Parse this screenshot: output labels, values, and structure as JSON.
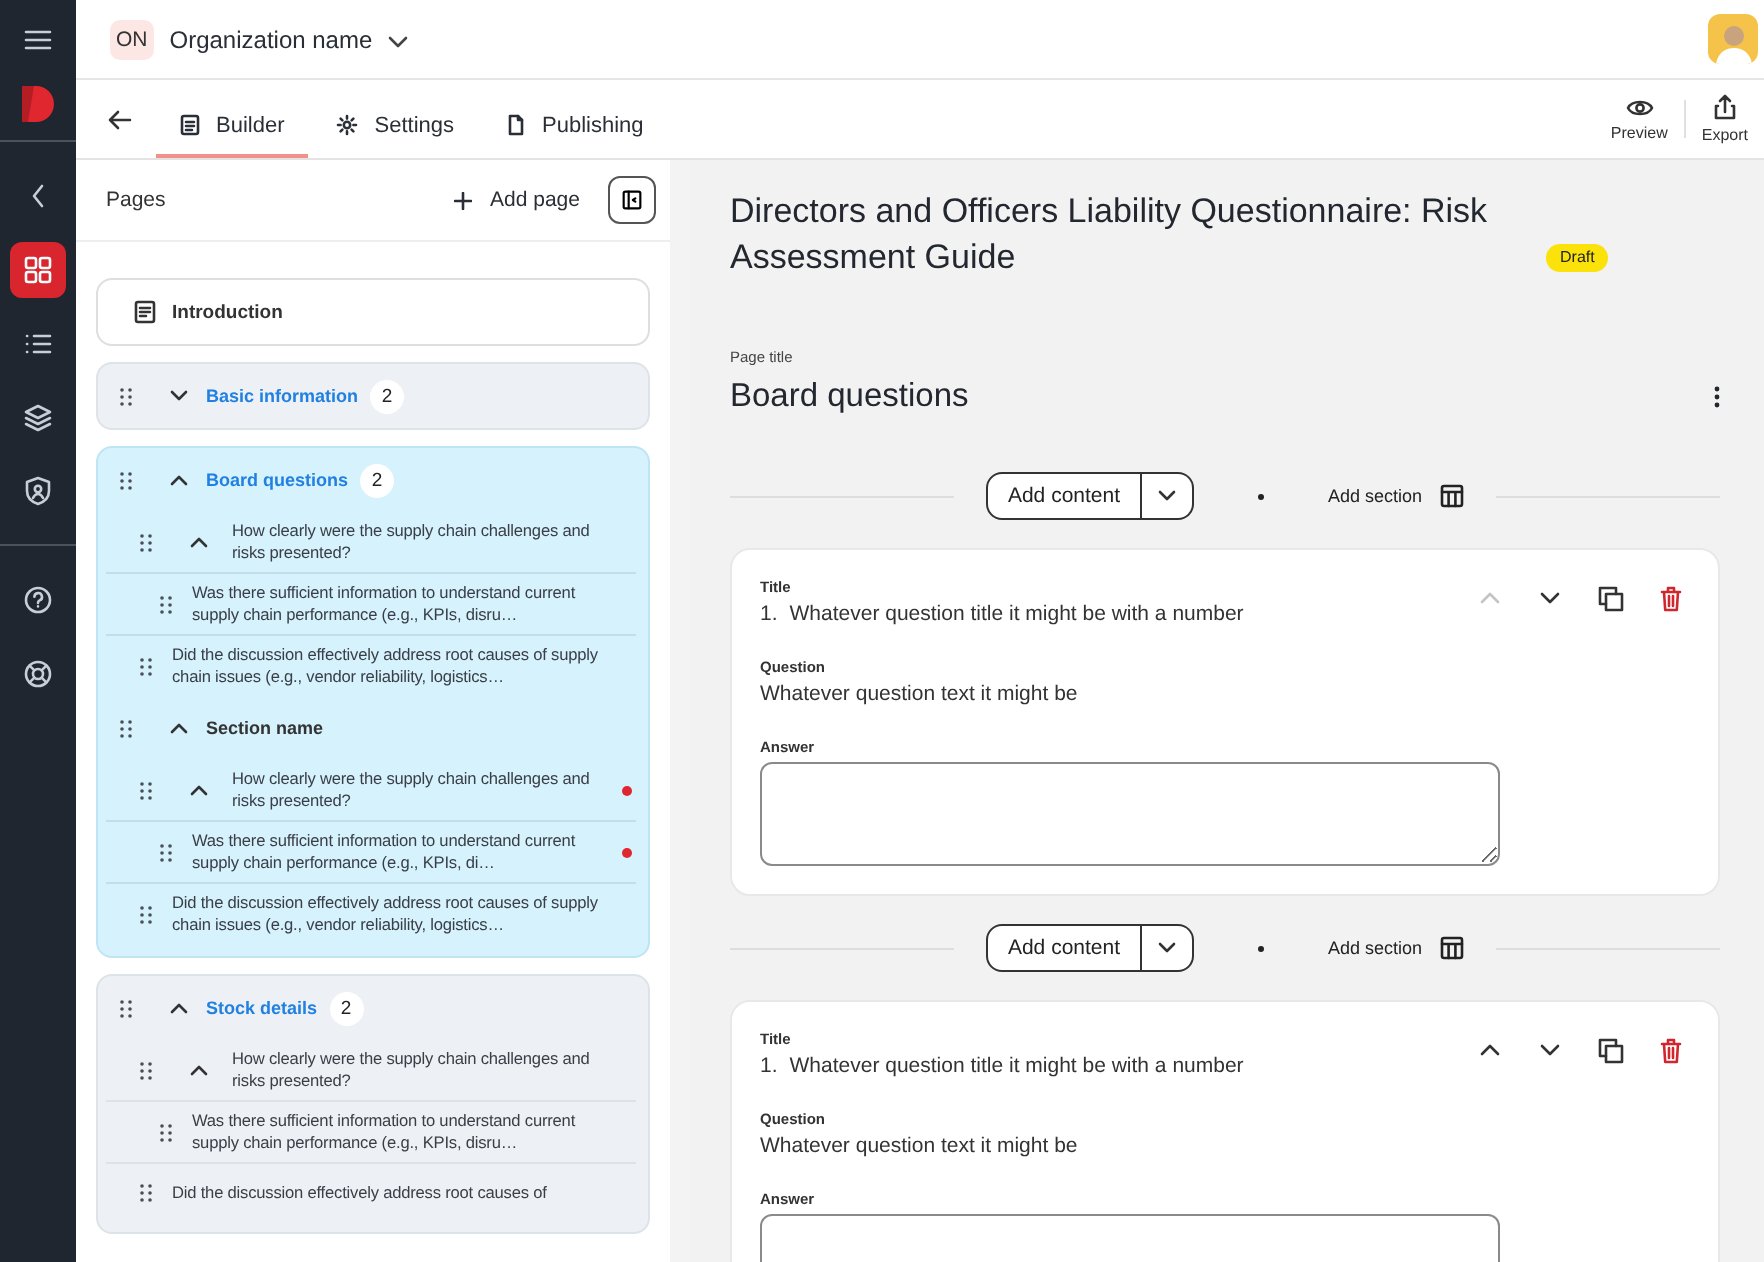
{
  "rail": {
    "items": [
      {
        "selected": false
      },
      {
        "selected": true
      },
      {
        "selected": false
      },
      {
        "selected": false
      },
      {
        "selected": false
      },
      {
        "selected": false
      },
      {
        "selected": false
      }
    ]
  },
  "topbar": {
    "org_initials": "ON",
    "org_name": "Organization name"
  },
  "toolbar": {
    "tabs": [
      {
        "label": "Builder",
        "selected": true
      },
      {
        "label": "Settings",
        "selected": false
      },
      {
        "label": "Publishing",
        "selected": false
      }
    ],
    "actions": [
      {
        "label": "Preview"
      },
      {
        "label": "Export"
      }
    ]
  },
  "pages": {
    "title": "Pages",
    "add_label": "Add page",
    "items": [
      {
        "kind": "page",
        "title": "Introduction"
      },
      {
        "kind": "group",
        "title": "Basic information",
        "count": "2",
        "expanded": false,
        "selected": false
      },
      {
        "kind": "group",
        "title": "Board questions",
        "count": "2",
        "expanded": true,
        "selected": true,
        "children": [
          {
            "kind": "question",
            "text": "How clearly were the supply chain challenges and risks presented?",
            "expanded": true,
            "flagged": false,
            "children": [
              {
                "kind": "question",
                "text": "Was there sufficient information to understand current supply chain performance (e.g., KPIs, disru…",
                "flagged": false
              }
            ]
          },
          {
            "kind": "question",
            "text": "Did the discussion effectively address root causes of supply chain issues (e.g., vendor reliability, logistics…",
            "flagged": false
          },
          {
            "kind": "section",
            "title": "Section name",
            "expanded": true,
            "children": [
              {
                "kind": "question",
                "text": "How clearly were the supply chain challenges and risks presented?",
                "expanded": true,
                "flagged": true,
                "children": [
                  {
                    "kind": "question",
                    "text": "Was there sufficient information to understand current supply chain performance (e.g., KPIs, di…",
                    "flagged": true
                  }
                ]
              },
              {
                "kind": "question",
                "text": "Did the discussion effectively address root causes of supply chain issues (e.g., vendor reliability, logistics…",
                "flagged": false
              }
            ]
          }
        ]
      },
      {
        "kind": "group",
        "title": "Stock details",
        "count": "2",
        "expanded": true,
        "selected": false,
        "children": [
          {
            "kind": "question",
            "text": "How clearly were the supply chain challenges and risks presented?",
            "expanded": true,
            "flagged": false,
            "children": [
              {
                "kind": "question",
                "text": "Was there sufficient information to understand current supply chain performance (e.g., KPIs, disru…",
                "flagged": false
              }
            ]
          },
          {
            "kind": "question",
            "text": "Did the discussion effectively address root causes of",
            "flagged": false
          }
        ]
      }
    ]
  },
  "main": {
    "title": "Directors and Officers Liability Questionnaire: Risk Assessment Guide",
    "status": "Draft",
    "page_title_label": "Page title",
    "page_title": "Board questions",
    "blocks": [
      {
        "kind": "add_bar",
        "add_content": "Add content",
        "add_section": "Add section"
      },
      {
        "kind": "question_card",
        "title_label": "Title",
        "number": "1.",
        "title": "Whatever question title it might be with a number",
        "question_label": "Question",
        "question": "Whatever question text it might be",
        "answer_label": "Answer",
        "move_up_disabled": true
      },
      {
        "kind": "add_bar",
        "add_content": "Add content",
        "add_section": "Add section"
      },
      {
        "kind": "question_card",
        "title_label": "Title",
        "number": "1.",
        "title": "Whatever question title it might be with a number",
        "question_label": "Question",
        "question": "Whatever question text it might be",
        "answer_label": "Answer",
        "move_up_disabled": false
      }
    ]
  }
}
